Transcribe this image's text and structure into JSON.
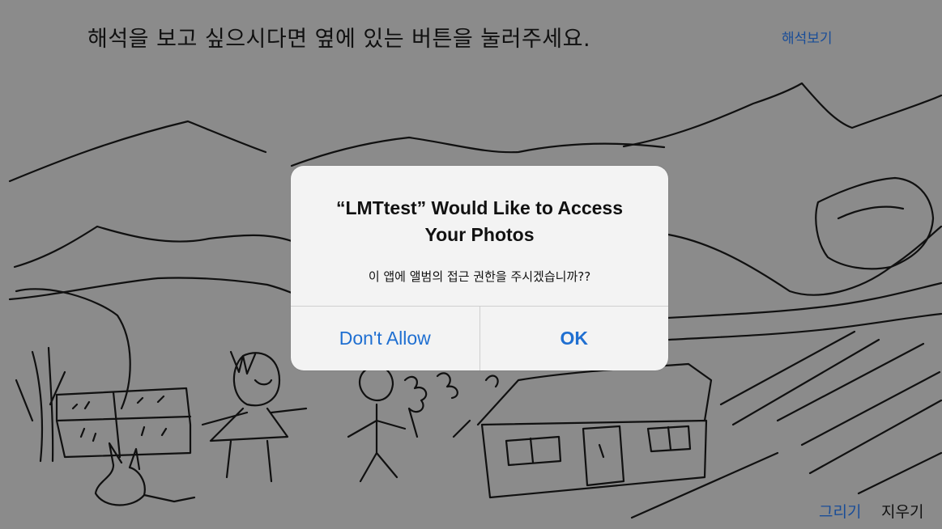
{
  "header": {
    "instruction_text": "해석을 보고 싶으시다면 옆에 있는 버튼을 눌러주세요.",
    "interpret_link": "해석보기"
  },
  "footer": {
    "draw_link": "그리기",
    "erase_link": "지우기"
  },
  "alert": {
    "title": "“LMTtest” Would Like to Access Your Photos",
    "message": "이 앱에 앨범의 접근 권한을 주시겠습니까??",
    "deny_label": "Don't Allow",
    "ok_label": "OK"
  },
  "colors": {
    "background": "#8e8e8e",
    "link_blue": "#1a4f9c",
    "alert_button_blue": "#1f6fd1",
    "alert_background": "#f3f3f3"
  }
}
